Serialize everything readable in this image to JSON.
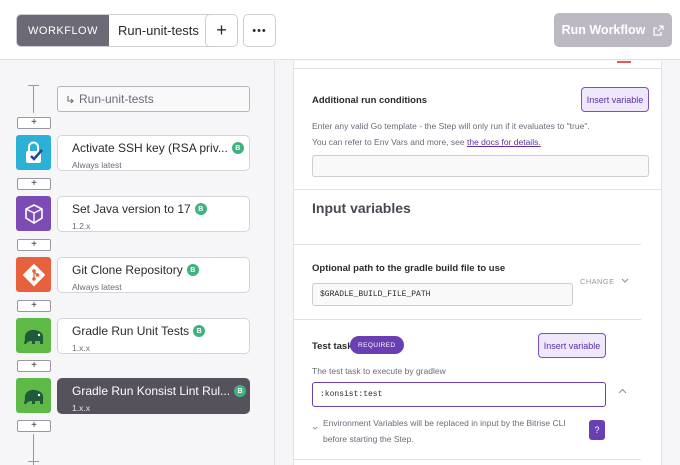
{
  "topbar": {
    "workflow_tag": "WORKFLOW",
    "workflow_name": "Run-unit-tests",
    "add_label": "+",
    "more_label": "•••",
    "run_label": "Run Workflow"
  },
  "sidebar": {
    "trigger_label": "Run-unit-tests",
    "add_step_label": "+",
    "steps": [
      {
        "title": "Activate SSH key (RSA priv...",
        "subtitle": "Always latest",
        "badge": "B",
        "icon": "ssh-key-lock-icon",
        "color": "#2bb1d6"
      },
      {
        "title": "Set Java version to 17",
        "subtitle": "1.2.x",
        "badge": "B",
        "icon": "java-cube-icon",
        "color": "#7c4bb3"
      },
      {
        "title": "Git Clone Repository",
        "subtitle": "Always latest",
        "badge": "B",
        "icon": "git-icon",
        "color": "#e8613c"
      },
      {
        "title": "Gradle Run Unit Tests",
        "subtitle": "1.x.x",
        "badge": "B",
        "icon": "gradle-elephant-icon",
        "color": "#5fb947"
      },
      {
        "title": "Gradle Run Konsist Lint Rul...",
        "subtitle": "1.x.x",
        "badge": "B",
        "icon": "gradle-elephant-icon",
        "color": "#5fb947"
      }
    ]
  },
  "panel": {
    "conditions_title": "Additional run conditions",
    "insert_variable_label": "Insert variable",
    "conditions_help_1": "Enter any valid Go template - the Step will only run if it evaluates to \"true\".",
    "conditions_help_2_prefix": "You can refer to Env Vars and more, see ",
    "conditions_help_2_link": "the docs for details.",
    "input_variables_title": "Input variables",
    "gradle_file_label": "Optional path to the gradle build file to use",
    "gradle_file_value": "$GRADLE_BUILD_FILE_PATH",
    "change_label": "CHANGE",
    "test_task_label": "Test task",
    "required_label": "REQUIRED",
    "test_task_help": "The test task to execute by gradlew",
    "test_task_value": ":konsist:test",
    "env_note_line1": "Environment Variables will be replaced in input by the Bitrise CLI",
    "env_note_line2": "before starting the Step.",
    "help_label": "?"
  },
  "colors": {
    "accent": "#6b3fb4",
    "run_button": "#bdb9c2",
    "selected_step": "#55525c"
  }
}
